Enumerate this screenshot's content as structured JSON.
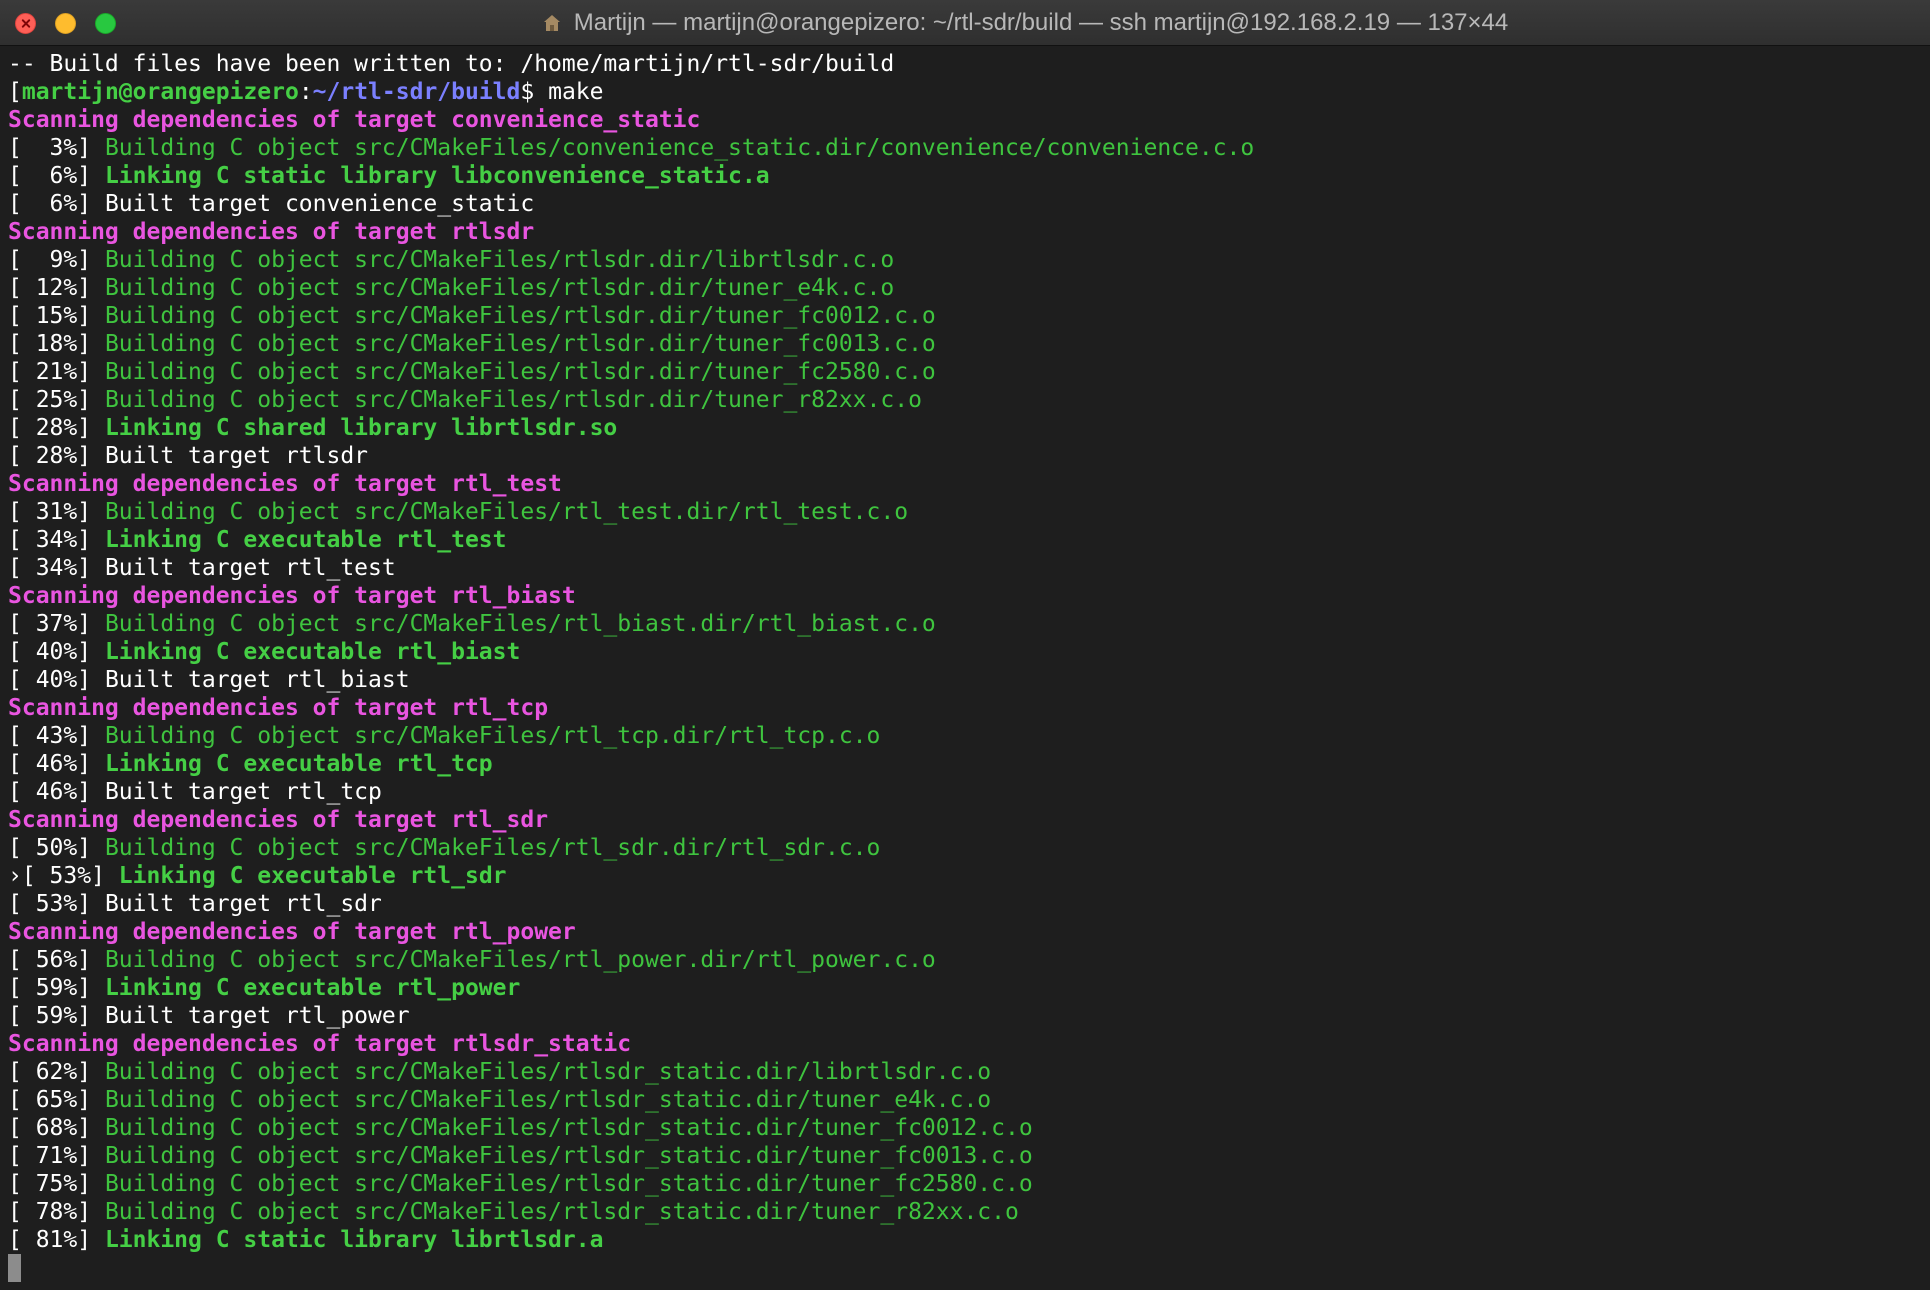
{
  "window": {
    "title": "Martijn — martijn@orangepizero: ~/rtl-sdr/build — ssh martijn@192.168.2.19 — 137×44",
    "title_icon": "house-icon",
    "buttons": [
      "close-button",
      "minimize-button",
      "zoom-button"
    ]
  },
  "terminal": {
    "lines": [
      {
        "kind": "plain",
        "text": "-- Build files have been written to: /home/martijn/rtl-sdr/build"
      },
      {
        "kind": "prompt",
        "marker": "[",
        "user": "martijn@orangepizero",
        "sep": ":",
        "path": "~/rtl-sdr/build",
        "dollar": "$ ",
        "command": "make"
      },
      {
        "kind": "scan",
        "text": "Scanning dependencies of target convenience_static"
      },
      {
        "kind": "build",
        "pct": "[  3%] ",
        "text": "Building C object src/CMakeFiles/convenience_static.dir/convenience/convenience.c.o"
      },
      {
        "kind": "link",
        "pct": "[  6%] ",
        "text": "Linking C static library libconvenience_static.a"
      },
      {
        "kind": "built",
        "pct": "[  6%] ",
        "text": "Built target convenience_static"
      },
      {
        "kind": "scan",
        "text": "Scanning dependencies of target rtlsdr"
      },
      {
        "kind": "build",
        "pct": "[  9%] ",
        "text": "Building C object src/CMakeFiles/rtlsdr.dir/librtlsdr.c.o"
      },
      {
        "kind": "build",
        "pct": "[ 12%] ",
        "text": "Building C object src/CMakeFiles/rtlsdr.dir/tuner_e4k.c.o"
      },
      {
        "kind": "build",
        "pct": "[ 15%] ",
        "text": "Building C object src/CMakeFiles/rtlsdr.dir/tuner_fc0012.c.o"
      },
      {
        "kind": "build",
        "pct": "[ 18%] ",
        "text": "Building C object src/CMakeFiles/rtlsdr.dir/tuner_fc0013.c.o"
      },
      {
        "kind": "build",
        "pct": "[ 21%] ",
        "text": "Building C object src/CMakeFiles/rtlsdr.dir/tuner_fc2580.c.o"
      },
      {
        "kind": "build",
        "pct": "[ 25%] ",
        "text": "Building C object src/CMakeFiles/rtlsdr.dir/tuner_r82xx.c.o"
      },
      {
        "kind": "link",
        "pct": "[ 28%] ",
        "text": "Linking C shared library librtlsdr.so"
      },
      {
        "kind": "built",
        "pct": "[ 28%] ",
        "text": "Built target rtlsdr"
      },
      {
        "kind": "scan",
        "text": "Scanning dependencies of target rtl_test"
      },
      {
        "kind": "build",
        "pct": "[ 31%] ",
        "text": "Building C object src/CMakeFiles/rtl_test.dir/rtl_test.c.o"
      },
      {
        "kind": "link",
        "pct": "[ 34%] ",
        "text": "Linking C executable rtl_test"
      },
      {
        "kind": "built",
        "pct": "[ 34%] ",
        "text": "Built target rtl_test"
      },
      {
        "kind": "scan",
        "text": "Scanning dependencies of target rtl_biast"
      },
      {
        "kind": "build",
        "pct": "[ 37%] ",
        "text": "Building C object src/CMakeFiles/rtl_biast.dir/rtl_biast.c.o"
      },
      {
        "kind": "link",
        "pct": "[ 40%] ",
        "text": "Linking C executable rtl_biast"
      },
      {
        "kind": "built",
        "pct": "[ 40%] ",
        "text": "Built target rtl_biast"
      },
      {
        "kind": "scan",
        "text": "Scanning dependencies of target rtl_tcp"
      },
      {
        "kind": "build",
        "pct": "[ 43%] ",
        "text": "Building C object src/CMakeFiles/rtl_tcp.dir/rtl_tcp.c.o"
      },
      {
        "kind": "link",
        "pct": "[ 46%] ",
        "text": "Linking C executable rtl_tcp"
      },
      {
        "kind": "built",
        "pct": "[ 46%] ",
        "text": "Built target rtl_tcp"
      },
      {
        "kind": "scan",
        "text": "Scanning dependencies of target rtl_sdr"
      },
      {
        "kind": "build",
        "pct": "[ 50%] ",
        "text": "Building C object src/CMakeFiles/rtl_sdr.dir/rtl_sdr.c.o"
      },
      {
        "kind": "link",
        "marker": "›",
        "pct": "[ 53%] ",
        "text": "Linking C executable rtl_sdr"
      },
      {
        "kind": "built",
        "pct": "[ 53%] ",
        "text": "Built target rtl_sdr"
      },
      {
        "kind": "scan",
        "text": "Scanning dependencies of target rtl_power"
      },
      {
        "kind": "build",
        "pct": "[ 56%] ",
        "text": "Building C object src/CMakeFiles/rtl_power.dir/rtl_power.c.o"
      },
      {
        "kind": "link",
        "pct": "[ 59%] ",
        "text": "Linking C executable rtl_power"
      },
      {
        "kind": "built",
        "pct": "[ 59%] ",
        "text": "Built target rtl_power"
      },
      {
        "kind": "scan",
        "text": "Scanning dependencies of target rtlsdr_static"
      },
      {
        "kind": "build",
        "pct": "[ 62%] ",
        "text": "Building C object src/CMakeFiles/rtlsdr_static.dir/librtlsdr.c.o"
      },
      {
        "kind": "build",
        "pct": "[ 65%] ",
        "text": "Building C object src/CMakeFiles/rtlsdr_static.dir/tuner_e4k.c.o"
      },
      {
        "kind": "build",
        "pct": "[ 68%] ",
        "text": "Building C object src/CMakeFiles/rtlsdr_static.dir/tuner_fc0012.c.o"
      },
      {
        "kind": "build",
        "pct": "[ 71%] ",
        "text": "Building C object src/CMakeFiles/rtlsdr_static.dir/tuner_fc0013.c.o"
      },
      {
        "kind": "build",
        "pct": "[ 75%] ",
        "text": "Building C object src/CMakeFiles/rtlsdr_static.dir/tuner_fc2580.c.o"
      },
      {
        "kind": "build",
        "pct": "[ 78%] ",
        "text": "Building C object src/CMakeFiles/rtlsdr_static.dir/tuner_r82xx.c.o"
      },
      {
        "kind": "link",
        "pct": "[ 81%] ",
        "text": "Linking C static library librtlsdr.a"
      },
      {
        "kind": "cursor"
      }
    ]
  },
  "colors": {
    "background": "#1e1e1e",
    "scan": "#e955e0",
    "build": "#3fc43f",
    "link": "#45cf45",
    "prompt_user": "#45cf45",
    "prompt_path": "#7b80ff"
  }
}
